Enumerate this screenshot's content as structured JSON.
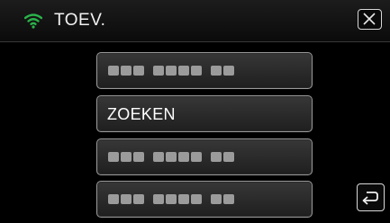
{
  "header": {
    "title": "TOEV.",
    "wifi_icon": "wifi-icon",
    "wifi_color": "#2bb34a",
    "close_icon": "close-icon"
  },
  "list": {
    "items": [
      {
        "type": "masked-network"
      },
      {
        "type": "text",
        "label": "ZOEKEN"
      },
      {
        "type": "masked-network"
      },
      {
        "type": "masked-network"
      }
    ]
  },
  "footer": {
    "back_icon": "return-icon"
  }
}
